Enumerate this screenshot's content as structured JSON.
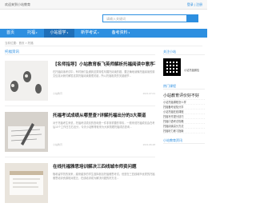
{
  "topbar": {
    "left": "欢迎来到小站教育",
    "right": "登录 | 注册"
  },
  "search": {
    "placeholder": "请输入关键词"
  },
  "nav": {
    "items": [
      {
        "label": "首页",
        "active": false
      },
      {
        "label": "托福",
        "active": false,
        "has_menu": true
      },
      {
        "label": "小站留学",
        "active": true,
        "has_menu": true
      },
      {
        "label": "新学考试",
        "active": false,
        "has_menu": true
      },
      {
        "label": "备考资料",
        "active": false,
        "has_menu": true
      }
    ],
    "chevron": "▾"
  },
  "breadcrumb": "当前位置：首页 > 托福",
  "main": {
    "section_title": "托福资讯",
    "articles": [
      {
        "title": "【名师指导】小站教育板飞英师解析托福阅读中意序不意影响",
        "desc": "在托福阅读考试中，有时我们会遇到这类特性句展托阅读的题，要正确地读懂托福阅读的原文信息对我们解答这类托福阅读题很关键，所以托福相关的关键细节...",
        "source": "小站教育",
        "date": "2021-07-01"
      },
      {
        "title": "托福考试成绩从哪里查?详解托福出分的3大渠道",
        "desc": "对于托福考生来说，托福考试成绩的查询是一件非常重要的事情，一般来说托福成绩会在考后10个工作日左右出分，今天小站教育就来为大家梳理托福成绩查询...",
        "source": "小站教育",
        "date": "2021-06-28"
      },
      {
        "title": "在线托福雅思培训解决三四线城市师资问题",
        "desc": "随着留学热的到来，越来越多的学生选择参加托福雅思考试，但是在三四线城市优质的托福雅思培训资源相对匮乏，在线培训成为解决问题的好方法...",
        "source": "小站教育",
        "date": "2021-06-25"
      }
    ]
  },
  "sidebar": {
    "follow_title": "关注小站",
    "qr_caption": "小站托福微信",
    "hot_title": "热门课程",
    "hot_list": [
      "小站教育评价好不好",
      "小站托福课程怎么样",
      "托福备考经验分享",
      "小站托福在线课程",
      "托福写作提分技巧",
      "托福口语考试攻略",
      "托福阅读高分方法",
      "托福听力练习指南"
    ],
    "news_title": "小站教育资讯"
  }
}
